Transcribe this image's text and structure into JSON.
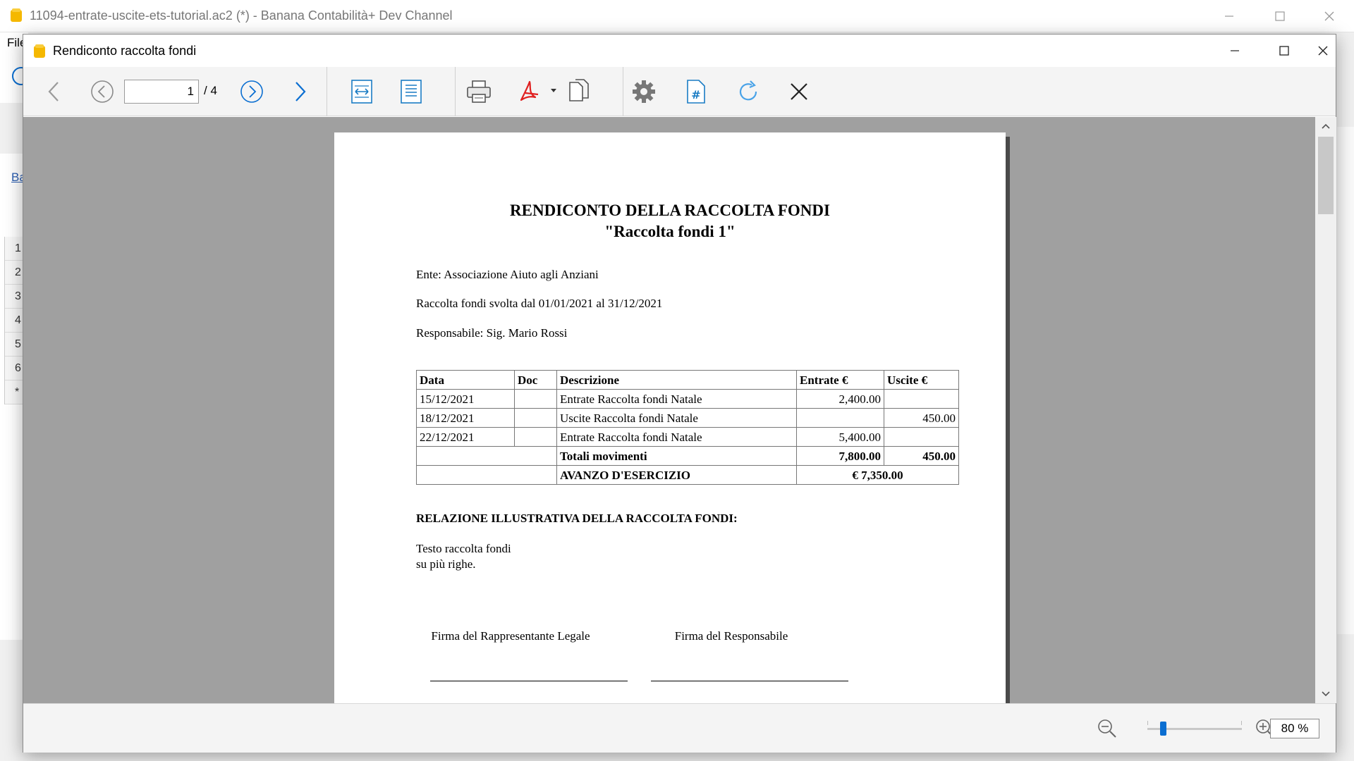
{
  "main_window": {
    "title": "11094-entrate-uscite-ets-tutorial.ac2 (*) - Banana Contabilità+ Dev Channel",
    "menu_file": "File",
    "link_fragment": "Ba",
    "row_numbers": [
      "1",
      "2",
      "3",
      "4",
      "5",
      "6",
      "*"
    ]
  },
  "dialog": {
    "title": "Rendiconto raccolta fondi",
    "page_current": "1",
    "page_total": "/ 4",
    "zoom": "80 %",
    "zoom_level_percent": 80
  },
  "document": {
    "title_line1": "RENDICONTO DELLA RACCOLTA FONDI",
    "title_line2": "\"Raccolta fondi 1\"",
    "ente": "Ente: Associazione Aiuto agli Anziani",
    "periodo": "Raccolta fondi svolta dal 01/01/2021 al 31/12/2021",
    "responsabile": "Responsabile: Sig. Mario Rossi",
    "table": {
      "headers": [
        "Data",
        "Doc",
        "Descrizione",
        "Entrate €",
        "Uscite €"
      ],
      "rows": [
        {
          "data": "15/12/2021",
          "doc": "",
          "descrizione": "Entrate Raccolta fondi Natale",
          "entrate": "2,400.00",
          "uscite": ""
        },
        {
          "data": "18/12/2021",
          "doc": "",
          "descrizione": "Uscite Raccolta fondi Natale",
          "entrate": "",
          "uscite": "450.00"
        },
        {
          "data": "22/12/2021",
          "doc": "",
          "descrizione": "Entrate Raccolta fondi Natale",
          "entrate": "5,400.00",
          "uscite": ""
        }
      ],
      "totals_label": "Totali movimenti",
      "totals_entrate": "7,800.00",
      "totals_uscite": "450.00",
      "avanzo_label": "AVANZO D'ESERCIZIO",
      "avanzo_value": "€ 7,350.00"
    },
    "section_title": "RELAZIONE ILLUSTRATIVA DELLA RACCOLTA FONDI:",
    "report_line1": "Testo raccolta fondi",
    "report_line2": "su più righe.",
    "sig_left": "Firma del Rappresentante Legale",
    "sig_right": "Firma del Responsabile"
  },
  "colors": {
    "accent": "#0a6ed1",
    "pdf_red": "#e02020",
    "app_icon": "#f5b800",
    "preview_bg": "#a0a0a0"
  },
  "icons": {
    "toolbar": [
      "back-arrow-icon",
      "previous-page-icon",
      "next-page-icon",
      "forward-arrow-icon",
      "fit-width-icon",
      "fit-page-icon",
      "print-icon",
      "pdf-icon",
      "copy-icon",
      "settings-icon",
      "page-number-icon",
      "refresh-icon",
      "close-icon"
    ],
    "status": [
      "zoom-out-icon",
      "zoom-in-icon"
    ]
  }
}
